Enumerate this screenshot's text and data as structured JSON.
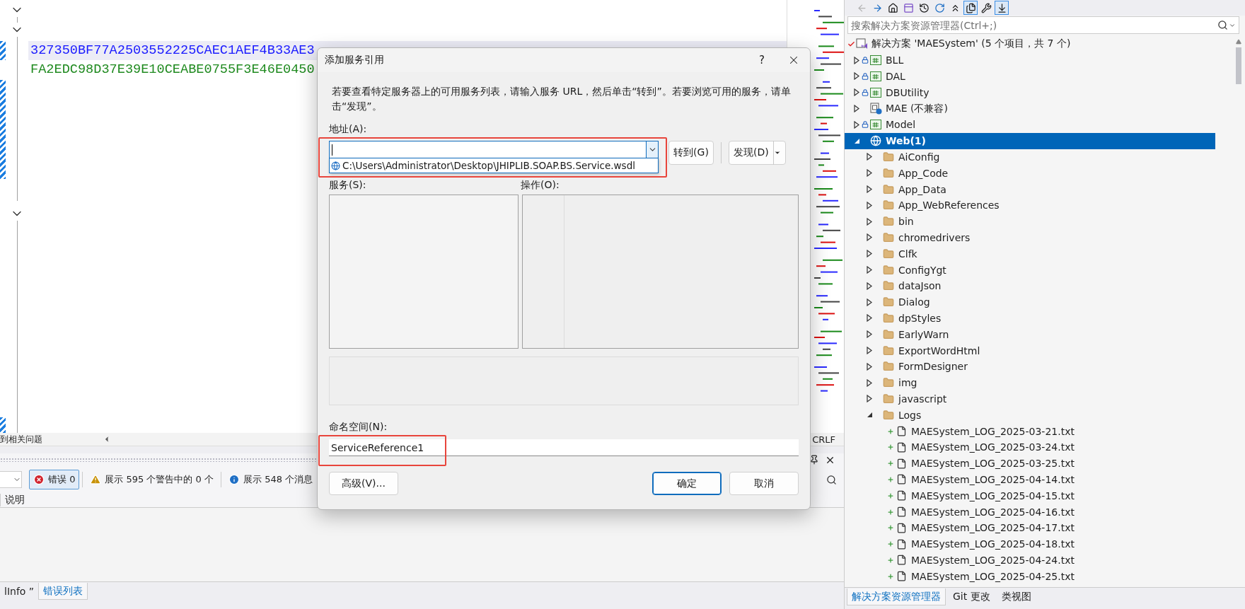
{
  "editor": {
    "code_lines": [
      {
        "text": "327350BF77A2503552225CAEC1AEF4B33AE3",
        "color": "#1a1aff",
        "current": true
      },
      {
        "text": "FA2EDC98D37E39E10CEABE0755F3E46E0450",
        "color": "#1f8a1f",
        "current": false
      }
    ],
    "status_text": "到相关问题",
    "line_ending": "CRLF"
  },
  "error_list": {
    "filters": [
      {
        "kind": "error",
        "label": "错误 0",
        "selected": true
      },
      {
        "kind": "warning",
        "label": "展示 595 个警告中的 0 个",
        "selected": false
      },
      {
        "kind": "info",
        "label": "展示 548 个消息",
        "selected": false
      }
    ],
    "columns": [
      "说明"
    ]
  },
  "bottom_tabs": [
    {
      "label": "lInfo ”",
      "selected": false
    },
    {
      "label": "错误列表",
      "selected": true
    }
  ],
  "dialog": {
    "title": "添加服务引用",
    "help": "?",
    "description": "若要查看特定服务器上的可用服务列表，请输入服务 URL，然后单击“转到”。若要浏览可用的服务，请单击“发现”。",
    "address": {
      "label": "地址(A):",
      "highlight": true,
      "suggestions": [
        "C:\\Users\\Administrator\\Desktop\\JHIPLIB.SOAP.BS.Service.wsdl"
      ]
    },
    "go_button": "转到(G)",
    "discover_button": "发现(D)",
    "services_label": "服务(S):",
    "operations_label": "操作(O):",
    "namespace": {
      "label": "命名空间(N):",
      "value": "ServiceReference1",
      "highlight": true
    },
    "buttons": [
      {
        "label": "高级(V)...",
        "default": false
      },
      {
        "label": "确定",
        "default": true
      },
      {
        "label": "取消",
        "default": false
      }
    ]
  },
  "solution_explorer": {
    "toolbar": [
      {
        "kind": "back",
        "pressed": false,
        "disabled": true
      },
      {
        "kind": "forward",
        "pressed": false,
        "disabled": false
      },
      {
        "kind": "home",
        "pressed": false,
        "disabled": false
      },
      {
        "kind": "switch-views",
        "pressed": false,
        "disabled": false
      },
      {
        "kind": "history",
        "pressed": false,
        "disabled": false
      },
      {
        "kind": "refresh",
        "pressed": false,
        "disabled": false
      },
      {
        "kind": "collapse",
        "pressed": false,
        "disabled": false
      },
      {
        "kind": "show-all",
        "pressed": true,
        "disabled": false
      },
      {
        "kind": "properties",
        "pressed": false,
        "disabled": false
      },
      {
        "kind": "preview",
        "pressed": true,
        "disabled": false
      }
    ],
    "search": {
      "placeholder": "搜索解决方案资源管理器(Ctrl+;)"
    },
    "tree": [
      {
        "label": "解决方案 'MAESystem' (5 个项目，共 7 个)",
        "kind": "solution",
        "modified": true,
        "selected": false,
        "children": [
          {
            "label": "BLL",
            "kind": "csharp-project",
            "locked": true,
            "expanded": false,
            "selected": false
          },
          {
            "label": "DAL",
            "kind": "csharp-project",
            "locked": true,
            "expanded": false,
            "selected": false
          },
          {
            "label": "DBUtility",
            "kind": "csharp-project",
            "locked": true,
            "expanded": false,
            "selected": false
          },
          {
            "label": "MAE (不兼容)",
            "kind": "incompatible-project",
            "locked": false,
            "expanded": false,
            "selected": false
          },
          {
            "label": "Model",
            "kind": "csharp-project",
            "locked": true,
            "expanded": false,
            "selected": false
          },
          {
            "label": "Web(1)",
            "kind": "web-project",
            "locked": false,
            "expanded": true,
            "selected": true,
            "children": [
              {
                "label": "AiConfig",
                "kind": "folder",
                "expanded": false,
                "selected": false
              },
              {
                "label": "App_Code",
                "kind": "folder",
                "expanded": false,
                "selected": false
              },
              {
                "label": "App_Data",
                "kind": "folder",
                "expanded": false,
                "selected": false
              },
              {
                "label": "App_WebReferences",
                "kind": "folder",
                "expanded": false,
                "selected": false
              },
              {
                "label": "bin",
                "kind": "folder",
                "expanded": false,
                "selected": false
              },
              {
                "label": "chromedrivers",
                "kind": "folder",
                "expanded": false,
                "selected": false
              },
              {
                "label": "Clfk",
                "kind": "folder",
                "expanded": false,
                "selected": false
              },
              {
                "label": "ConfigYgt",
                "kind": "folder",
                "expanded": false,
                "selected": false
              },
              {
                "label": "dataJson",
                "kind": "folder",
                "expanded": false,
                "selected": false
              },
              {
                "label": "Dialog",
                "kind": "folder",
                "expanded": false,
                "selected": false
              },
              {
                "label": "dpStyles",
                "kind": "folder",
                "expanded": false,
                "selected": false
              },
              {
                "label": "EarlyWarn",
                "kind": "folder",
                "expanded": false,
                "selected": false
              },
              {
                "label": "ExportWordHtml",
                "kind": "folder",
                "expanded": false,
                "selected": false
              },
              {
                "label": "FormDesigner",
                "kind": "folder",
                "expanded": false,
                "selected": false
              },
              {
                "label": "img",
                "kind": "folder",
                "expanded": false,
                "selected": false
              },
              {
                "label": "javascript",
                "kind": "folder",
                "expanded": false,
                "selected": false
              },
              {
                "label": "Logs",
                "kind": "folder",
                "expanded": true,
                "selected": false,
                "children": [
                  {
                    "label": "MAESystem_LOG_2025-03-21.txt",
                    "kind": "file",
                    "added": true,
                    "selected": false
                  },
                  {
                    "label": "MAESystem_LOG_2025-03-24.txt",
                    "kind": "file",
                    "added": true,
                    "selected": false
                  },
                  {
                    "label": "MAESystem_LOG_2025-03-25.txt",
                    "kind": "file",
                    "added": true,
                    "selected": false
                  },
                  {
                    "label": "MAESystem_LOG_2025-04-14.txt",
                    "kind": "file",
                    "added": true,
                    "selected": false
                  },
                  {
                    "label": "MAESystem_LOG_2025-04-15.txt",
                    "kind": "file",
                    "added": true,
                    "selected": false
                  },
                  {
                    "label": "MAESystem_LOG_2025-04-16.txt",
                    "kind": "file",
                    "added": true,
                    "selected": false
                  },
                  {
                    "label": "MAESystem_LOG_2025-04-17.txt",
                    "kind": "file",
                    "added": true,
                    "selected": false
                  },
                  {
                    "label": "MAESystem_LOG_2025-04-18.txt",
                    "kind": "file",
                    "added": true,
                    "selected": false
                  },
                  {
                    "label": "MAESystem_LOG_2025-04-24.txt",
                    "kind": "file",
                    "added": true,
                    "selected": false
                  },
                  {
                    "label": "MAESystem_LOG_2025-04-25.txt",
                    "kind": "file",
                    "added": true,
                    "selected": false
                  }
                ]
              }
            ]
          }
        ]
      }
    ],
    "tabs": [
      {
        "label": "解决方案资源管理器",
        "selected": true
      },
      {
        "label": "Git 更改",
        "selected": false
      },
      {
        "label": "类视图",
        "selected": false
      }
    ]
  }
}
